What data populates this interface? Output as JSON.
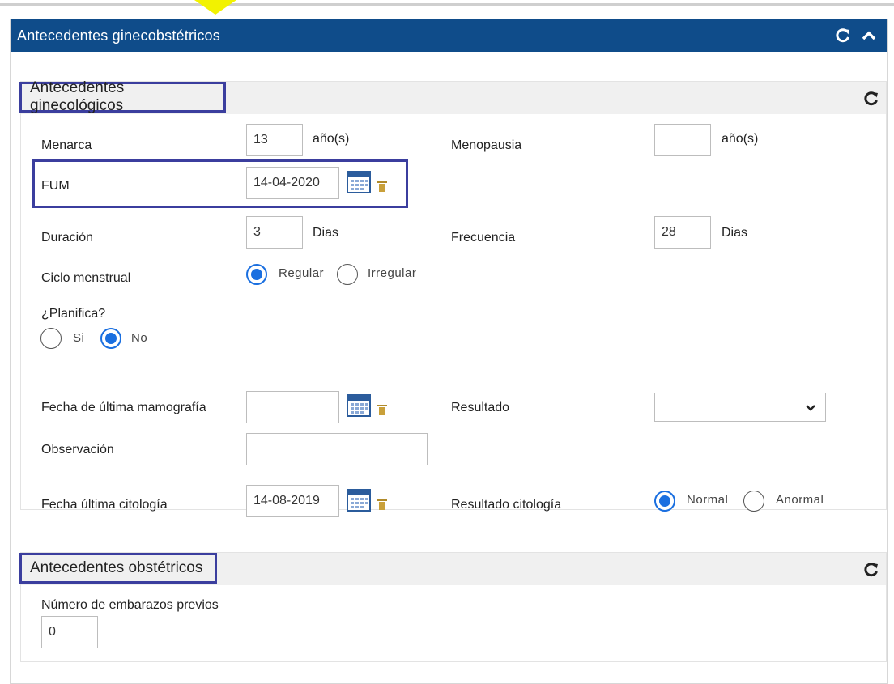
{
  "panel": {
    "title": "Antecedentes ginecobstétricos"
  },
  "gineco": {
    "title": "Antecedentes ginecológicos",
    "menarca": {
      "label": "Menarca",
      "value": "13",
      "unit": "año(s)"
    },
    "menopausia": {
      "label": "Menopausia",
      "value": "",
      "unit": "año(s)"
    },
    "fum": {
      "label": "FUM",
      "value": "14-04-2020"
    },
    "duracion": {
      "label": "Duración",
      "value": "3",
      "unit": "Dias"
    },
    "frecuencia": {
      "label": "Frecuencia",
      "value": "28",
      "unit": "Dias"
    },
    "ciclo": {
      "label": "Ciclo menstrual",
      "options": [
        "Regular",
        "Irregular"
      ],
      "selected": "Regular"
    },
    "planifica": {
      "label": "¿Planifica?",
      "options": [
        "Si",
        "No"
      ],
      "selected": "No"
    },
    "mamografia": {
      "label": "Fecha de última mamografía",
      "value": ""
    },
    "resultado": {
      "label": "Resultado",
      "value": ""
    },
    "observacion": {
      "label": "Observación",
      "value": ""
    },
    "citologia": {
      "label": "Fecha última citología",
      "value": "14-08-2019"
    },
    "resultado_citologia": {
      "label": "Resultado citología",
      "options": [
        "Normal",
        "Anormal"
      ],
      "selected": "Normal"
    }
  },
  "obste": {
    "title": "Antecedentes obstétricos",
    "embarazos": {
      "label": "Número de embarazos previos",
      "value": "0"
    }
  },
  "colors": {
    "header": "#0f4c8a",
    "accent": "#1a6fe0",
    "highlight": "#3b3e9e"
  },
  "icons": [
    "refresh-icon",
    "chevron-up-icon",
    "calendar-icon",
    "trash-icon",
    "chevron-down-icon"
  ]
}
